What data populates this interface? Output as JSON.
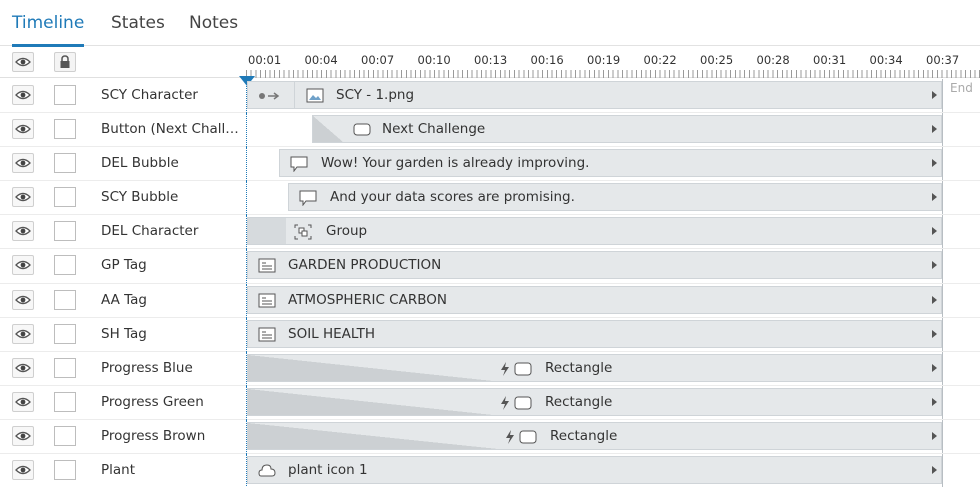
{
  "tabs": [
    {
      "label": "Timeline",
      "active": true
    },
    {
      "label": "States",
      "active": false
    },
    {
      "label": "Notes",
      "active": false
    }
  ],
  "ruler": {
    "labels": [
      "00:01",
      "00:04",
      "00:07",
      "00:10",
      "00:13",
      "00:16",
      "00:19",
      "00:22",
      "00:25",
      "00:28",
      "00:31",
      "00:34",
      "00:37"
    ]
  },
  "end_label": "End",
  "icons": {
    "visibility": "eye-icon",
    "lock": "lock-icon",
    "image": "image-icon",
    "button": "button-icon",
    "bubble": "speech-bubble-icon",
    "group": "group-icon",
    "text": "text-caption-icon",
    "effect": "lightning-icon",
    "shape": "rounded-rectangle-icon",
    "cloud": "cloud-shape-icon",
    "motion": "motion-path-icon"
  },
  "colors": {
    "accent": "#1f7ab8",
    "bar": "#e5e8ea"
  },
  "rows": [
    {
      "name": "SCY Character",
      "bar_label": "SCY - 1.png"
    },
    {
      "name": "Button (Next Challen...",
      "bar_label": "Next Challenge"
    },
    {
      "name": "DEL Bubble",
      "bar_label": "Wow! Your garden is already improving."
    },
    {
      "name": "SCY Bubble",
      "bar_label": "And your data scores are promising."
    },
    {
      "name": "DEL Character",
      "bar_label": "Group"
    },
    {
      "name": "GP Tag",
      "bar_label": "GARDEN PRODUCTION"
    },
    {
      "name": "AA Tag",
      "bar_label": "ATMOSPHERIC CARBON"
    },
    {
      "name": "SH Tag",
      "bar_label": "SOIL HEALTH"
    },
    {
      "name": "Progress Blue",
      "bar_label": "Rectangle"
    },
    {
      "name": "Progress Green",
      "bar_label": "Rectangle"
    },
    {
      "name": "Progress Brown",
      "bar_label": "Rectangle"
    },
    {
      "name": "Plant",
      "bar_label": "plant icon 1"
    }
  ]
}
